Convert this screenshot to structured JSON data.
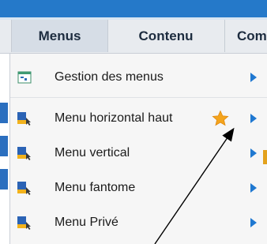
{
  "menubar": {
    "tabs": [
      {
        "label": "Menus",
        "active": true
      },
      {
        "label": "Contenu",
        "active": false
      },
      {
        "label": "Com",
        "active": false
      }
    ]
  },
  "dropdown": {
    "items": [
      {
        "label": "Gestion des menus",
        "icon": "menu-manager-icon",
        "submenu": true
      },
      {
        "label": "Menu horizontal haut",
        "icon": "menu-item-icon",
        "submenu": true,
        "starred": true
      },
      {
        "label": "Menu vertical",
        "icon": "menu-item-icon",
        "submenu": true
      },
      {
        "label": "Menu fantome",
        "icon": "menu-item-icon",
        "submenu": true
      },
      {
        "label": "Menu Privé",
        "icon": "menu-item-icon",
        "submenu": true
      }
    ]
  },
  "colors": {
    "topbar": "#2579c9",
    "menubar": "#e8ebef",
    "arrow": "#1f78d1",
    "star": "#f4a41c"
  }
}
